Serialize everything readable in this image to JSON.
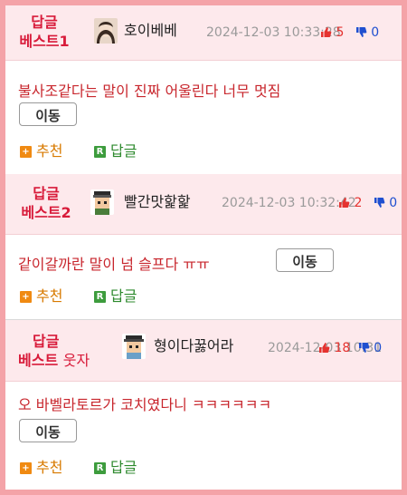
{
  "posts": [
    {
      "rank_label": "답글",
      "rank_sub": "베스트1",
      "nickname": "호이베베",
      "date": "2024-12-03 10:33:28",
      "up": "5",
      "down": "0",
      "content": "불사조같다는 말이 진짜 어울린다 너무 멋짐",
      "move_label": "이동",
      "recommend_label": "추천",
      "reply_label": "답글",
      "avatar_icon": "profile-photo"
    },
    {
      "rank_label": "답글",
      "rank_sub": "베스트2",
      "nickname": "빨간맛핥핥",
      "date": "2024-12-03 10:32:42",
      "up": "2",
      "down": "0",
      "content": "같이갈까란 말이 넘 슬프다 ㅠㅠ",
      "move_label": "이동",
      "recommend_label": "추천",
      "reply_label": "답글",
      "avatar_icon": "pixel-character"
    },
    {
      "rank_label": "답글",
      "rank_sub": "베스트",
      "rank_extra": "웃자",
      "nickname": "형이다꿇어라",
      "date": "2024-12-03 10:31",
      "up": "18",
      "down": "0",
      "content": "오 바벨라토르가 코치였다니 ㅋㅋㅋㅋㅋㅋ",
      "move_label": "이동",
      "recommend_label": "추천",
      "reply_label": "답글",
      "avatar_icon": "pixel-character"
    }
  ],
  "icons": {
    "thumbs_up": "thumbs-up-icon",
    "thumbs_down": "thumbs-down-icon",
    "recommend": "plus-icon",
    "reply": "r-icon"
  },
  "colors": {
    "accent": "#d81b3a",
    "content": "#c8262d",
    "up": "#e5322f",
    "down": "#1f4fd0",
    "recommend": "#d87a00",
    "reply": "#2e8a2e",
    "header_bg": "#fde9ec",
    "frame": "#f4a3a8"
  }
}
